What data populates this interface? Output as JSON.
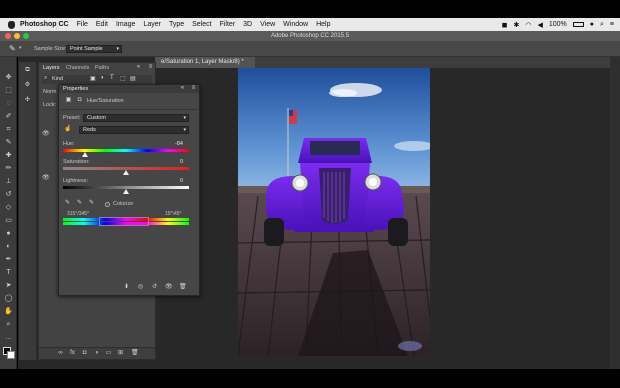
{
  "menubar": {
    "app_name": "Photoshop CC",
    "items": [
      "File",
      "Edit",
      "Image",
      "Layer",
      "Type",
      "Select",
      "Filter",
      "3D",
      "View",
      "Window",
      "Help"
    ],
    "battery": "100%"
  },
  "window": {
    "title": "Adobe Photoshop CC 2015.5",
    "traffic_colors": [
      "#ff5f57",
      "#ffbd2e",
      "#28c940"
    ]
  },
  "options_bar": {
    "sample_size_label": "Sample Size:",
    "sample_size_value": "Point Sample"
  },
  "document_tab": {
    "label": "e/Saturation 1, Layer Mask/8) *"
  },
  "layers_panel": {
    "tabs": [
      "Layers",
      "Channels",
      "Paths"
    ],
    "kind_label": "Kind",
    "norm_label": "Norm",
    "lock_label": "Lock:"
  },
  "properties_panel": {
    "title": "Properties",
    "adjustment_name": "Hue/Saturation",
    "preset_label": "Preset:",
    "preset_value": "Custom",
    "channel_value": "Reds",
    "hue_label": "Hue:",
    "hue_value": "-84",
    "saturation_label": "Saturation:",
    "saturation_value": "0",
    "lightness_label": "Lightness:",
    "lightness_value": "0",
    "colorize_label": "Colorize",
    "range_left": "315°/345°",
    "range_right": "15°\\45°"
  }
}
